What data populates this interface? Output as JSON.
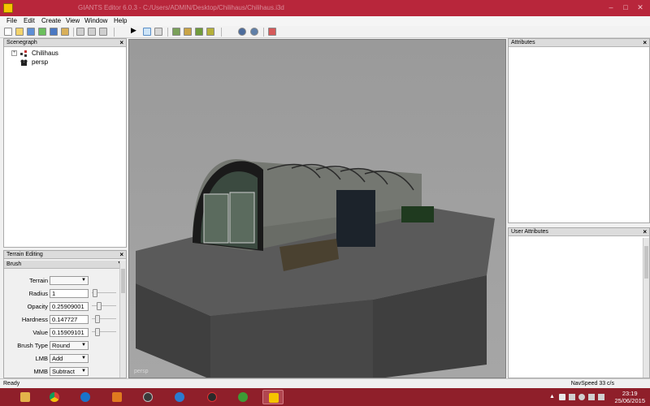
{
  "window": {
    "title": "GIANTS Editor 6.0.3 - C:/Users/ADMIN/Desktop/Chilihaus/Chilihaus.i3d"
  },
  "menu": [
    "File",
    "Edit",
    "Create",
    "View",
    "Window",
    "Help"
  ],
  "toolbar": {
    "icons": [
      "new-icon",
      "open-icon",
      "save-icon",
      "refresh-icon",
      "save-all-icon",
      "import-icon",
      "undo-icon",
      "redo-icon",
      "play-icon",
      "select-icon",
      "move-icon",
      "terrain-icon",
      "paint-icon",
      "foliage-icon",
      "settings-icon",
      "light-icon",
      "render-icon"
    ]
  },
  "scenegraph": {
    "title": "Scenegraph",
    "close": "×",
    "items": [
      {
        "label": "Chilihaus",
        "expander": "+"
      },
      {
        "label": "persp",
        "expander": ""
      }
    ]
  },
  "attributes": {
    "title": "Attributes",
    "close": "×"
  },
  "user_attributes": {
    "title": "User Attributes",
    "close": "×"
  },
  "viewport": {
    "camera": "persp"
  },
  "terrain_editing": {
    "title": "Terrain Editing",
    "close": "×",
    "section": "Brush",
    "fields": {
      "terrain": {
        "label": "Terrain",
        "value": ""
      },
      "radius": {
        "label": "Radius",
        "value": "1",
        "slider": 0.05
      },
      "opacity": {
        "label": "Opacity",
        "value": "0.25909001",
        "slider": 0.26
      },
      "hardness": {
        "label": "Hardness",
        "value": "0.147727",
        "slider": 0.15
      },
      "value": {
        "label": "Value",
        "value": "0.15909101",
        "slider": 0.16
      },
      "brush_type": {
        "label": "Brush Type",
        "value": "Round"
      },
      "lmb": {
        "label": "LMB",
        "value": "Add"
      },
      "mmb": {
        "label": "MMB",
        "value": "Subtract"
      }
    }
  },
  "status": {
    "left": "Ready",
    "right": "NavSpeed 33 c/s"
  },
  "taskbar": {
    "time": "23:19",
    "date": "25/06/2015",
    "apps": [
      "explorer-icon",
      "chrome-icon",
      "teamviewer-icon",
      "archive-icon",
      "media-icon",
      "globe-icon",
      "antivirus-icon",
      "xbox-icon",
      "giants-editor-icon"
    ]
  },
  "colors": {
    "titlebar": "#b8263b",
    "taskbar": "#8f1f2a",
    "viewport_bg": "#9c9c9c"
  }
}
